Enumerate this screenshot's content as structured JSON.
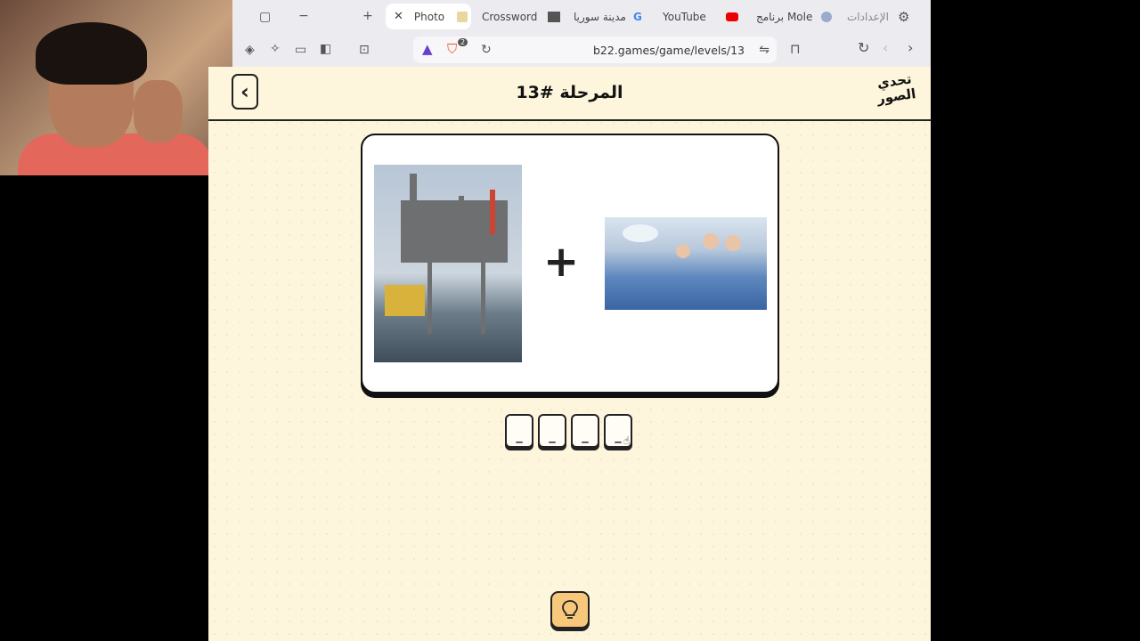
{
  "browser": {
    "tabs": [
      {
        "label": "Photo"
      },
      {
        "label": "Crossword"
      },
      {
        "label": "مدينة سوريا"
      },
      {
        "label": "YouTube"
      },
      {
        "label": "برنامج Mole"
      },
      {
        "label": "الإعدادات"
      }
    ],
    "url": "b22.games/game/levels/13",
    "shield_count": "2"
  },
  "game": {
    "title": "المرحلة #13",
    "logo_line1": "تحدي",
    "logo_line2": "الصور",
    "plus": "+",
    "slots": [
      "_",
      "_",
      "_",
      "_"
    ],
    "images": [
      "offshore-oil-rig-photo",
      "surgeons-operating-room-photo"
    ]
  },
  "colors": {
    "page_bg": "#fdf6dc",
    "hint_button": "#f7c87c",
    "border": "#222222"
  }
}
